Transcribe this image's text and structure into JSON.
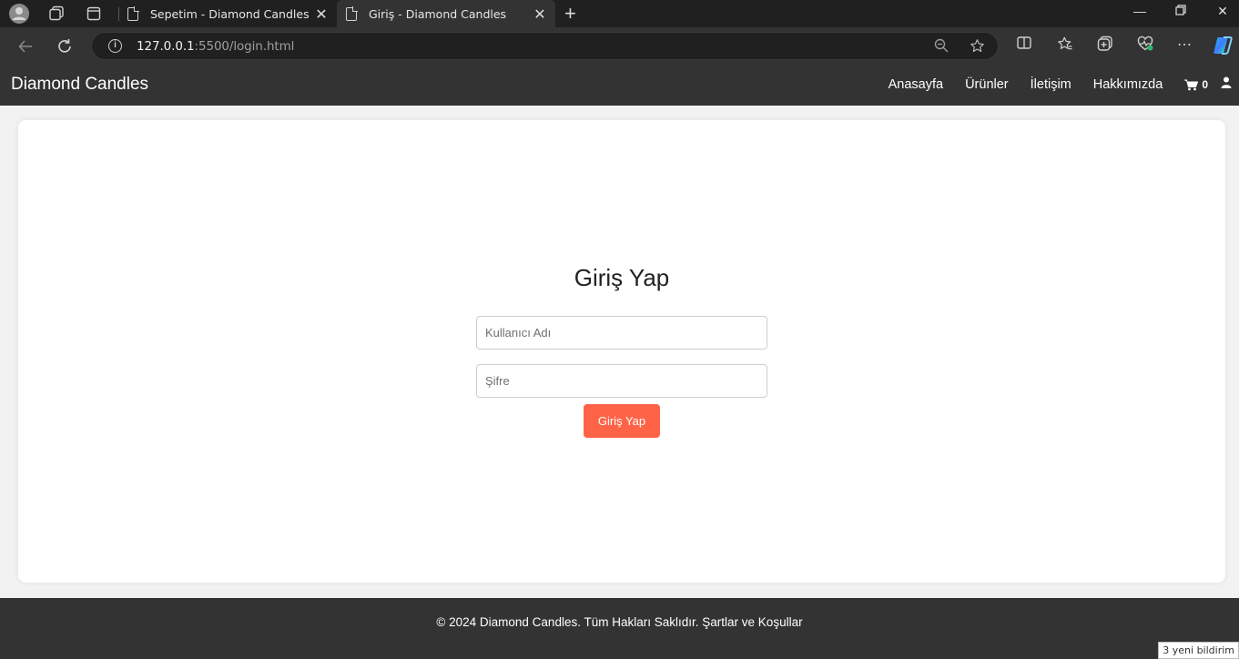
{
  "browser": {
    "tabs": [
      {
        "title": "Sepetim - Diamond Candles",
        "active": false
      },
      {
        "title": "Giriş - Diamond Candles",
        "active": true
      }
    ],
    "url_host": "127.0.0.1",
    "url_rest": ":5500/login.html",
    "notification": "3 yeni bildirim"
  },
  "site": {
    "brand": "Diamond Candles",
    "nav": [
      {
        "label": "Anasayfa"
      },
      {
        "label": "Ürünler"
      },
      {
        "label": "İletişim"
      },
      {
        "label": "Hakkımızda"
      }
    ],
    "cart_count": "0"
  },
  "login": {
    "title": "Giriş Yap",
    "username_placeholder": "Kullanıcı Adı",
    "password_placeholder": "Şifre",
    "submit_label": "Giriş Yap"
  },
  "footer": {
    "text": "© 2024 Diamond Candles. Tüm Hakları Saklıdır.",
    "terms_link": "Şartlar ve Koşullar"
  },
  "colors": {
    "nav_bg": "#333333",
    "button_bg": "#ff6347",
    "page_bg": "#f2f2f2"
  }
}
